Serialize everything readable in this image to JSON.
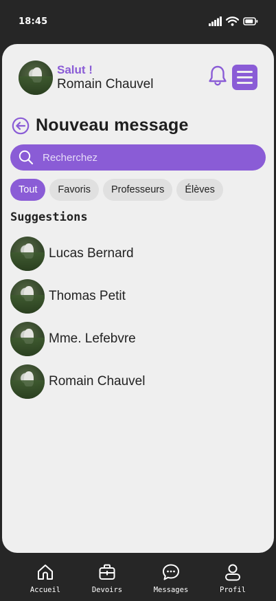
{
  "status": {
    "time": "18:45"
  },
  "header": {
    "greeting": "Salut !",
    "user_name": "Romain Chauvel"
  },
  "page": {
    "title": "Nouveau message"
  },
  "search": {
    "placeholder": "Recherchez"
  },
  "filters": [
    {
      "label": "Tout",
      "active": true
    },
    {
      "label": "Favoris",
      "active": false
    },
    {
      "label": "Professeurs",
      "active": false
    },
    {
      "label": "Élèves",
      "active": false
    }
  ],
  "suggestions": {
    "title": "Suggestions",
    "contacts": [
      {
        "name": "Lucas Bernard"
      },
      {
        "name": "Thomas Petit"
      },
      {
        "name": "Mme. Lefebvre"
      },
      {
        "name": "Romain Chauvel"
      }
    ]
  },
  "nav": {
    "items": [
      {
        "label": "Accueil",
        "icon": "home-icon"
      },
      {
        "label": "Devoirs",
        "icon": "briefcase-icon"
      },
      {
        "label": "Messages",
        "icon": "chat-bubble-icon"
      },
      {
        "label": "Profil",
        "icon": "user-icon"
      }
    ]
  },
  "colors": {
    "accent": "#8a5cd6",
    "background": "#262626",
    "card": "#efefef"
  }
}
